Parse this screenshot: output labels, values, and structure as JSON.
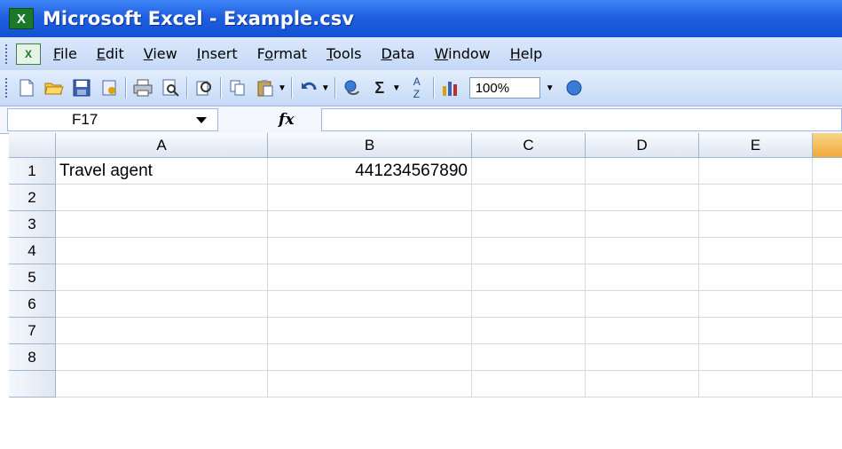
{
  "window": {
    "title": "Microsoft Excel - Example.csv",
    "app_icon": "excel-icon"
  },
  "menu": [
    {
      "id": "file",
      "prefix": "",
      "accel": "F",
      "rest": "ile"
    },
    {
      "id": "edit",
      "prefix": "",
      "accel": "E",
      "rest": "dit"
    },
    {
      "id": "view",
      "prefix": "",
      "accel": "V",
      "rest": "iew"
    },
    {
      "id": "insert",
      "prefix": "",
      "accel": "I",
      "rest": "nsert"
    },
    {
      "id": "format",
      "prefix": "F",
      "accel": "o",
      "rest": "rmat"
    },
    {
      "id": "tools",
      "prefix": "",
      "accel": "T",
      "rest": "ools"
    },
    {
      "id": "data",
      "prefix": "",
      "accel": "D",
      "rest": "ata"
    },
    {
      "id": "window",
      "prefix": "",
      "accel": "W",
      "rest": "indow"
    },
    {
      "id": "help",
      "prefix": "",
      "accel": "H",
      "rest": "elp"
    }
  ],
  "toolbar": {
    "zoom_value": "100%"
  },
  "formula_bar": {
    "name_box": "F17",
    "fx_label": "fx",
    "formula": ""
  },
  "columns": [
    "A",
    "B",
    "C",
    "D",
    "E",
    ""
  ],
  "rows": [
    "1",
    "2",
    "3",
    "4",
    "5",
    "6",
    "7",
    "8"
  ],
  "cells": {
    "A1": "Travel agent",
    "B1": "441234567890"
  },
  "colors": {
    "title_bar": "#1f5fe0",
    "menu_bg": "#c4d8f6",
    "selected_column_header": "#f2a93a"
  }
}
